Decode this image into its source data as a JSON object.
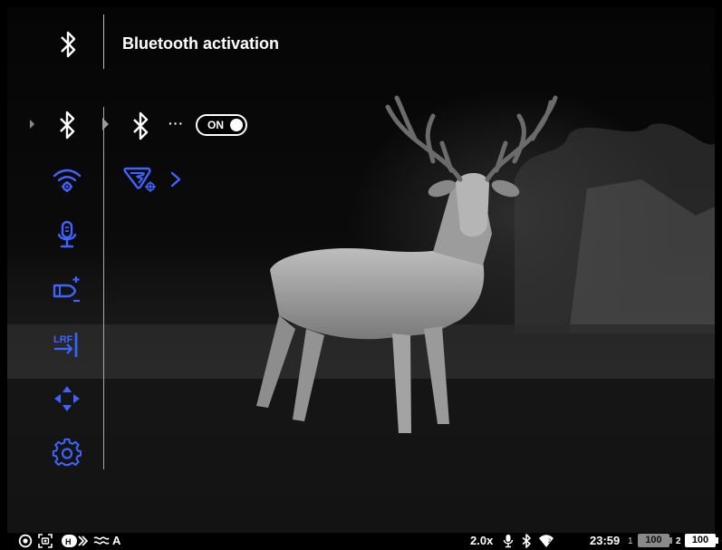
{
  "header": {
    "icon": "bluetooth-icon",
    "title": "Bluetooth activation"
  },
  "colors": {
    "accent_blue": "#3e64ff",
    "text": "#ffffff",
    "divider": "#a8a8a8",
    "background": "#000000"
  },
  "menu": {
    "items": [
      {
        "icon": "bluetooth-icon",
        "selected": true
      },
      {
        "icon": "wifi-settings-icon",
        "selected": false
      },
      {
        "icon": "microphone-icon",
        "selected": false
      },
      {
        "icon": "ballistic-profile-add-icon",
        "selected": false
      },
      {
        "icon": "lrf-icon",
        "selected": false
      },
      {
        "icon": "crosshair-calibration-icon",
        "selected": false
      },
      {
        "icon": "gear-icon",
        "selected": false
      }
    ]
  },
  "submenu": {
    "bluetooth_icon": "bluetooth-icon",
    "dots": "···",
    "toggle_label": "ON",
    "toggle_state": true,
    "app_icon": "stream-vision-app-icon",
    "chevron_icon": "chevron-right-icon"
  },
  "status": {
    "zoom": "2.0x",
    "time": "23:59",
    "battery1_index": "1",
    "battery1_level": "100",
    "battery2_index": "2",
    "battery2_level": "100",
    "mode_letter": "A"
  }
}
